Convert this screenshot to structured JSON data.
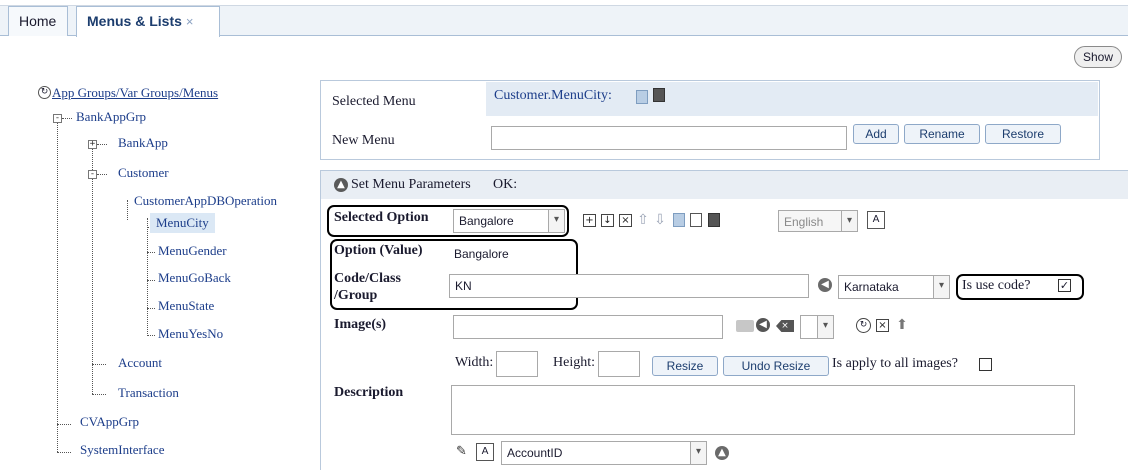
{
  "tabs": [
    {
      "label": "Home"
    },
    {
      "label": "Menus & Lists",
      "close": "×"
    }
  ],
  "toolbar": {
    "show_label": "Show"
  },
  "tree": {
    "root": "App Groups/Var Groups/Menus",
    "items": {
      "bankappgrp": "BankAppGrp",
      "bankapp": "BankApp",
      "customer": "Customer",
      "dbop": "CustomerAppDBOperation",
      "menucity": "MenuCity",
      "menugender": "MenuGender",
      "menugoback": "MenuGoBack",
      "menustate": "MenuState",
      "menuyesno": "MenuYesNo",
      "account": "Account",
      "transaction": "Transaction",
      "cvappgrp": "CVAppGrp",
      "sysif": "SystemInterface"
    }
  },
  "menu_panel": {
    "selected_menu_label": "Selected Menu",
    "selected_menu_value": "Customer.MenuCity:",
    "new_menu_label": "New Menu",
    "new_menu_value": "",
    "add_label": "Add",
    "rename_label": "Rename",
    "restore_label": "Restore"
  },
  "params": {
    "header": "Set Menu Parameters",
    "status": "OK:",
    "selected_option_label": "Selected Option",
    "selected_option_value": "Bangalore",
    "language_value": "English",
    "option_value_label": "Option (Value)",
    "option_value": "Bangalore",
    "code_label_1": "Code/Class",
    "code_label_2": "/Group",
    "code_value": "KN",
    "group_value": "Karnataka",
    "use_code_label": "Is use code?",
    "use_code_checked": "✓",
    "images_label": "Image(s)",
    "images_value": "",
    "width_label": "Width:",
    "height_label": "Height:",
    "width_value": "",
    "height_value": "",
    "resize_label": "Resize",
    "undo_resize_label": "Undo Resize",
    "apply_all_label": "Is apply to all images?",
    "description_label": "Description",
    "description_value": "",
    "field_value": "AccountID"
  }
}
